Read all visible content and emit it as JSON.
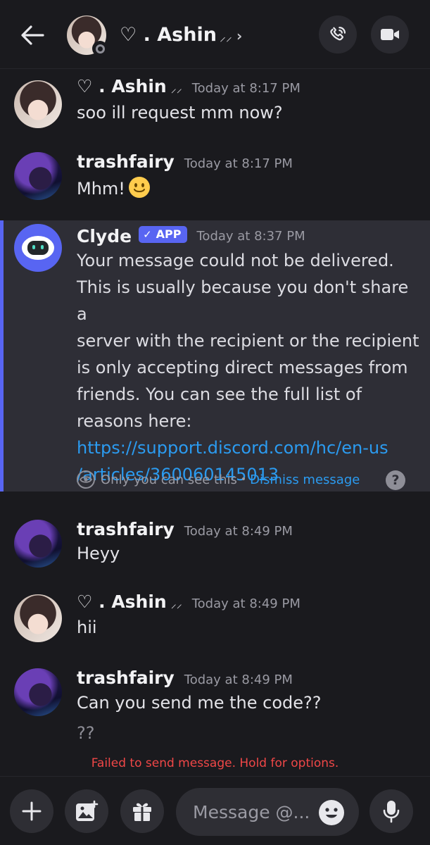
{
  "header": {
    "title": "♡ . Ashin",
    "title_ticks": "⸝⸝",
    "chevron": "›"
  },
  "messages": [
    {
      "author": "♡ . Ashin",
      "ticks": "⸝⸝",
      "time": "Today at 8:17 PM",
      "lines": [
        "soo ill request mm now?"
      ]
    },
    {
      "author": "trashfairy",
      "time": "Today at 8:17 PM",
      "lines": [
        "Mhm!"
      ]
    },
    {
      "author": "trashfairy",
      "time": "Today at 8:49 PM",
      "lines": [
        "Heyy"
      ]
    },
    {
      "author": "♡ . Ashin",
      "ticks": "⸝⸝",
      "time": "Today at 8:49 PM",
      "lines": [
        "hii"
      ]
    },
    {
      "author": "trashfairy",
      "time": "Today at 8:49 PM",
      "lines": [
        "Can you send me the code??",
        "??"
      ]
    }
  ],
  "clyde": {
    "author": "Clyde",
    "badge": "APP",
    "badge_check": "✓",
    "time": "Today at 8:37 PM",
    "text_lines": [
      "Your message could not be delivered.",
      "This is usually because you don't share a",
      "server with the recipient or the recipient",
      "is only accepting direct messages from",
      "friends. You can see the full list of",
      "reasons here:"
    ],
    "link_lines": [
      "https://support.discord.com/hc/en-us",
      "/articles/360060145013"
    ],
    "only_you": "Only you can see this",
    "separator": "•",
    "dismiss": "Dismiss message",
    "help": "?"
  },
  "failed_notice": "Failed to send message. Hold for options.",
  "composer": {
    "placeholder": "Message @..."
  },
  "colors": {
    "background": "#1a1a1e",
    "blurple": "#5865f2",
    "link": "#2b9bf0",
    "error": "#f04747",
    "ephemeral_bg": "#2e2e36"
  },
  "icons": [
    "back-arrow-icon",
    "phone-call-icon",
    "video-camera-icon",
    "slightly-smiling-face-emoji",
    "clyde-robot-icon",
    "eye-icon",
    "help-icon",
    "plus-icon",
    "image-icon",
    "gift-icon",
    "emoji-icon",
    "microphone-icon"
  ]
}
